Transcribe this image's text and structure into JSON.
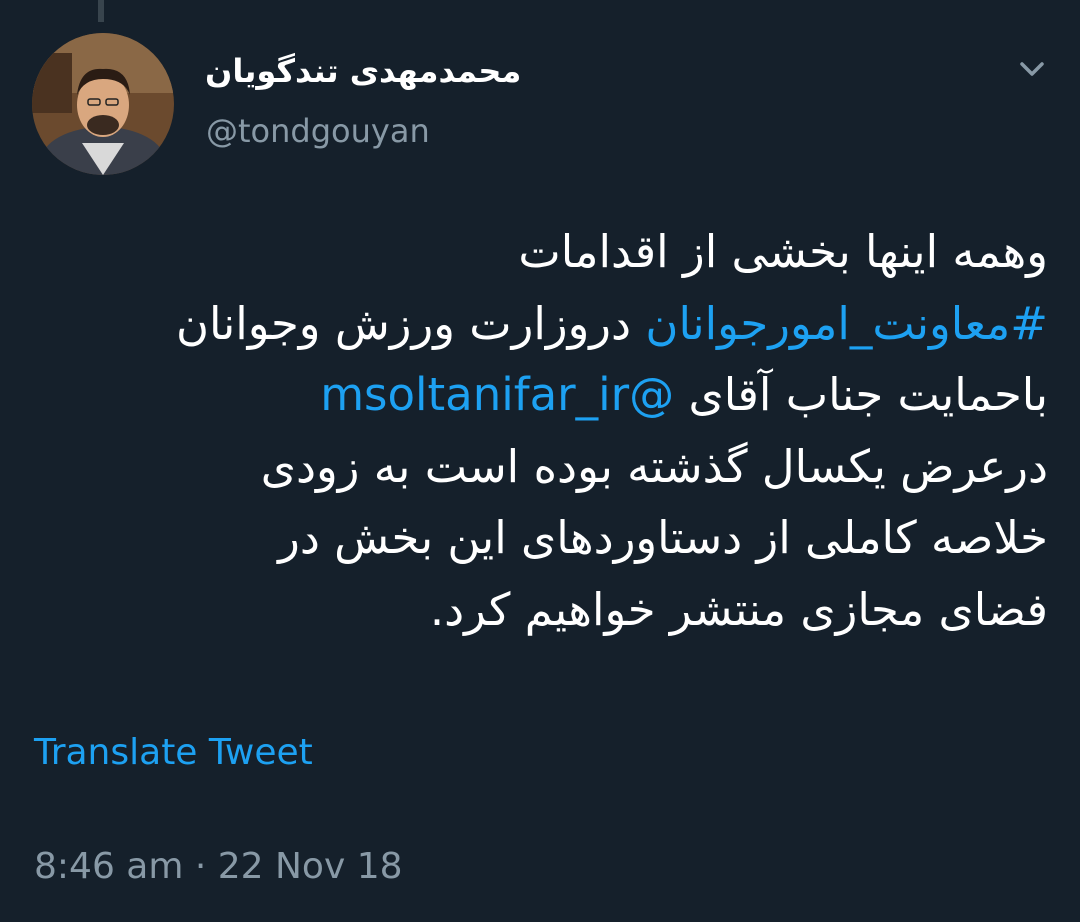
{
  "author": {
    "display_name": "محمدمهدی تندگویان",
    "handle": "@tondgouyan"
  },
  "icons": {
    "menu": "chevron-down-icon",
    "avatar": "profile-photo"
  },
  "colors": {
    "background": "#15202b",
    "text": "#ffffff",
    "secondary_text": "#8899a6",
    "link": "#1da1f2",
    "thread_line": "#38444d"
  },
  "tweet": {
    "line1": "وهمه اینها بخشی از اقدامات",
    "hashtag": "#معاونت_امورجوانان",
    "line2_rest": " دروزارت ورزش وجوانان",
    "line3_prefix": "باحمایت جناب آقای ",
    "mention": "@msoltanifar_ir",
    "line4": "درعرض یکسال گذشته بوده است به زودی",
    "line5": "خلاصه کاملی از دستاوردهای این بخش در",
    "line6": "فضای مجازی منتشر خواهیم کرد."
  },
  "translate_label": "Translate Tweet",
  "meta": {
    "timestamp": "8:46 am · 22 Nov 18"
  }
}
